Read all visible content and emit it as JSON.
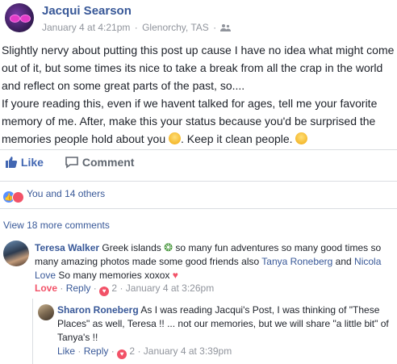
{
  "post": {
    "author": "Jacqui Searson",
    "date": "January 4 at 4:21pm",
    "dot": "·",
    "location": "Glenorchy, TAS",
    "privacy_icon": "friends-icon",
    "paragraph1": "Slightly nervy about putting this post up cause I have no idea what might come out of it, but some times its nice to take a break from all the crap in the world and reflect on some great parts of the past, so....",
    "paragraph2a": "If youre reading this, even if we havent talked for ages, tell me your favorite memory of me. After, make this your status because you'd be surprised the memories people hold about you ",
    "paragraph2b": ". Keep it clean people. ",
    "emoji1": "smiling-face-emoji",
    "emoji2": "laughing-face-emoji"
  },
  "actions": {
    "like_label": "Like",
    "comment_label": "Comment"
  },
  "reactions": {
    "summary": "You and 14 others",
    "types": [
      "like",
      "love"
    ]
  },
  "view_more": "View 18 more comments",
  "comments": [
    {
      "author": "Teresa Walker",
      "text1": "Greek islands ",
      "emoji": "palm-tree-emoji",
      "text2": " so many fun adventures so many good times so many amazing photos made some good friends also ",
      "mention1": "Tanya Roneberg",
      "and": " and ",
      "mention2": "Nicola Love",
      "text3": " So many memories xoxox ",
      "emoji_end": "heart-emoji",
      "reaction_label": "Love",
      "reply_label": "Reply",
      "reaction_count": "2",
      "time": "January 4 at 3:26pm"
    },
    {
      "author": "Sharon Roneberg",
      "text": "As I was reading Jacqui's Post, I was thinking of \"These Places\" as well, Teresa !! ... not our memories, but we will share \"a little bit\" of Tanya's !!",
      "like_label": "Like",
      "reply_label": "Reply",
      "reaction_count": "2",
      "time": "January 4 at 3:39pm"
    }
  ],
  "colors": {
    "link": "#385898",
    "love": "#f25268",
    "like": "#5890ff",
    "meta": "#90949c"
  }
}
